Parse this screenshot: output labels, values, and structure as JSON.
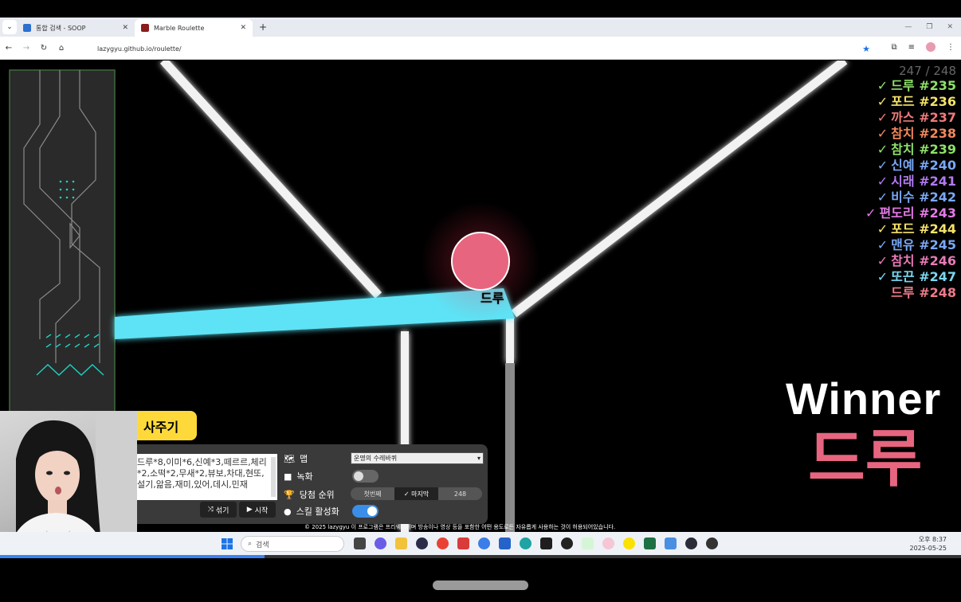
{
  "browser": {
    "tabs": [
      {
        "label": "통합 검색 - SOOP",
        "active": false
      },
      {
        "label": "Marble Roulette",
        "active": true
      }
    ],
    "new_tab": "+",
    "url": "lazygyu.github.io/roulette/"
  },
  "game": {
    "count": "247 / 248",
    "ranking": [
      {
        "check": "✓",
        "name": "드루",
        "rank": "#235",
        "color": "#8fe06a"
      },
      {
        "check": "✓",
        "name": "포드",
        "rank": "#236",
        "color": "#f5e36a"
      },
      {
        "check": "✓",
        "name": "까스",
        "rank": "#237",
        "color": "#f07a7a"
      },
      {
        "check": "✓",
        "name": "참치",
        "rank": "#238",
        "color": "#f2895c"
      },
      {
        "check": "✓",
        "name": "참치",
        "rank": "#239",
        "color": "#8fe06a"
      },
      {
        "check": "✓",
        "name": "신예",
        "rank": "#240",
        "color": "#7aa8f5"
      },
      {
        "check": "✓",
        "name": "시래",
        "rank": "#241",
        "color": "#b27af0"
      },
      {
        "check": "✓",
        "name": "비수",
        "rank": "#242",
        "color": "#7aa8f5"
      },
      {
        "check": "✓",
        "name": "편도리",
        "rank": "#243",
        "color": "#e47ae8"
      },
      {
        "check": "✓",
        "name": "포드",
        "rank": "#244",
        "color": "#f5e36a"
      },
      {
        "check": "✓",
        "name": "맨유",
        "rank": "#245",
        "color": "#7aa8f5"
      },
      {
        "check": "✓",
        "name": "참치",
        "rank": "#246",
        "color": "#e87ab8"
      },
      {
        "check": "✓",
        "name": "또끈",
        "rank": "#247",
        "color": "#7ad8f0"
      },
      {
        "check": "",
        "name": "드루",
        "rank": "#248",
        "color": "#f07a8a"
      }
    ],
    "winner_label": "Winner",
    "winner_name": "드루",
    "ball_label": "드루",
    "colors": {
      "ball": "#e8657f",
      "neon": "#5de3f5",
      "wall": "#f2f2f2"
    }
  },
  "controls": {
    "give_button": "사주기",
    "names_text": "드루*8,이미*6,신예*3,떼르르,체리*2,소떡*2,무새*2,뷰보,차대,현또,설기,앎음,재미,있어,데시,민재",
    "shuffle_label": "섞기",
    "start_label": "시작",
    "map_label": "맵",
    "map_value": "운명의 수레바퀴",
    "record_label": "녹화",
    "record_on": false,
    "rank_label": "당첨 순위",
    "rank_options": [
      "첫번째",
      "마지막"
    ],
    "rank_selected": "마지막",
    "rank_value": "248",
    "skill_label": "스킬 활성화",
    "skill_on": true
  },
  "footer_note": "© 2025 lazygyu 이 프로그램은 프리웨어이며 방송이나 영상 등을 포함한 어떤 용도로든 자유롭게 사용하는 것이 허용되어있습니다.",
  "taskbar": {
    "search_placeholder": "검색",
    "time": "오후 8:37",
    "date": "2025-05-25"
  },
  "video": {
    "progress": 0.275
  }
}
